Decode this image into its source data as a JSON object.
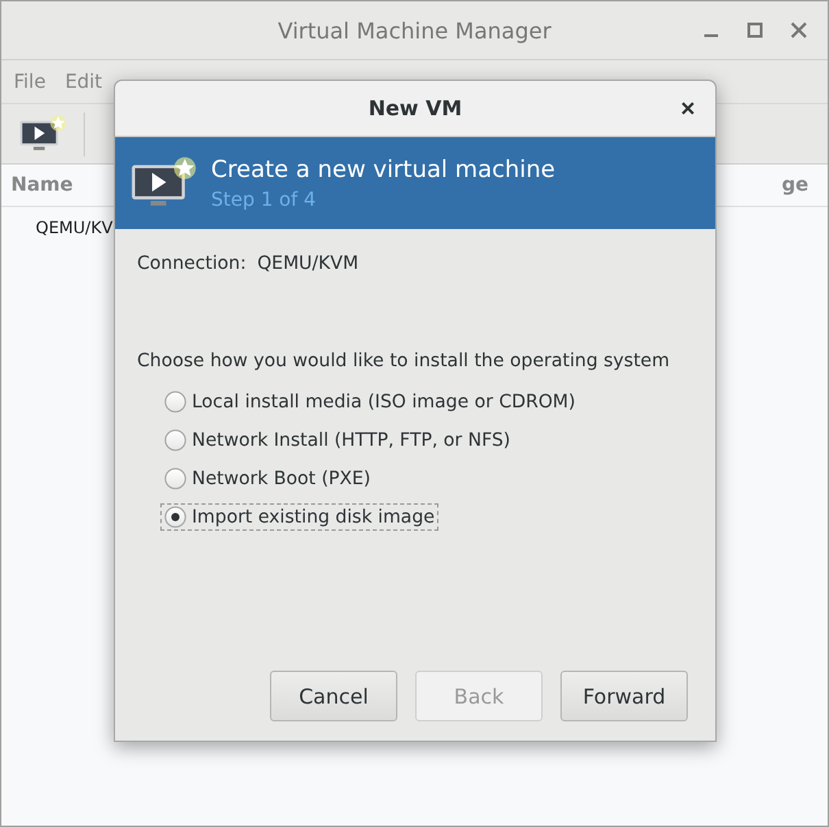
{
  "window": {
    "title": "Virtual Machine Manager"
  },
  "menu": [
    "File",
    "Edit"
  ],
  "columns": [
    "Name",
    "ge"
  ],
  "rows": [
    "QEMU/KV"
  ],
  "dialog": {
    "title": "New VM",
    "close": "×",
    "heading": "Create a new virtual machine",
    "step": "Step 1 of 4",
    "connection_label": "Connection:",
    "connection_value": "QEMU/KVM",
    "prompt": "Choose how you would like to install the operating system",
    "options": [
      {
        "label": "Local install media (ISO image or CDROM)",
        "selected": false
      },
      {
        "label": "Network Install (HTTP, FTP, or NFS)",
        "selected": false
      },
      {
        "label": "Network Boot (PXE)",
        "selected": false
      },
      {
        "label": "Import existing disk image",
        "selected": true
      }
    ],
    "buttons": [
      {
        "label": "Cancel",
        "disabled": false
      },
      {
        "label": "Back",
        "disabled": true
      },
      {
        "label": "Forward",
        "disabled": false
      }
    ]
  }
}
